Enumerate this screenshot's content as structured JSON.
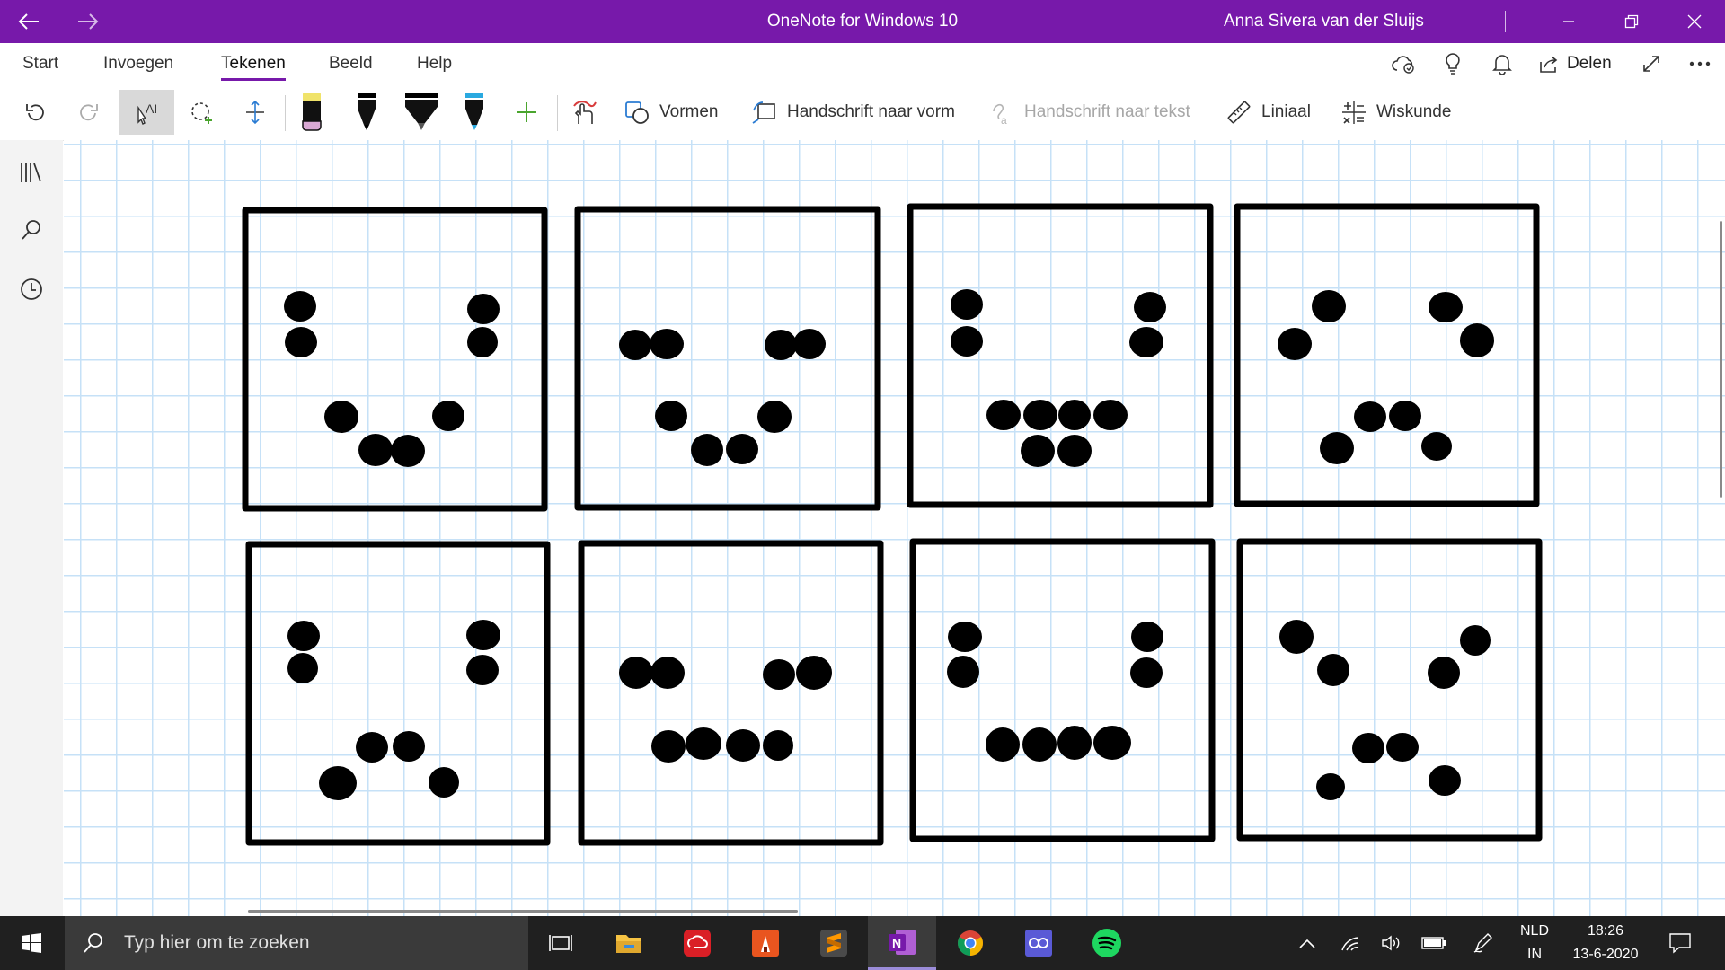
{
  "titlebar": {
    "title": "OneNote for Windows 10",
    "user": "Anna Sivera van der Sluijs"
  },
  "menu": {
    "tabs": [
      "Start",
      "Invoegen",
      "Tekenen",
      "Beeld",
      "Help"
    ],
    "active": "Tekenen",
    "share_label": "Delen"
  },
  "toolbar": {
    "shapes_label": "Vormen",
    "ink_to_shape_label": "Handschrift naar vorm",
    "ink_to_text_label": "Handschrift naar tekst",
    "ruler_label": "Liniaal",
    "math_label": "Wiskunde",
    "pens": [
      {
        "name": "highlighter-pen",
        "color": "#f0e36a"
      },
      {
        "name": "black-pen",
        "color": "#000000"
      },
      {
        "name": "black-marker",
        "color": "#000000"
      },
      {
        "name": "blue-pen",
        "color": "#2aa9e0"
      }
    ]
  },
  "taskbar": {
    "search_placeholder": "Typ hier om te zoeken",
    "language_line1": "NLD",
    "language_line2": "IN",
    "time": "18:26",
    "date": "13-6-2020"
  },
  "colors": {
    "accent": "#7719aa",
    "grid": "#c6e1f7",
    "ink": "#000000"
  }
}
